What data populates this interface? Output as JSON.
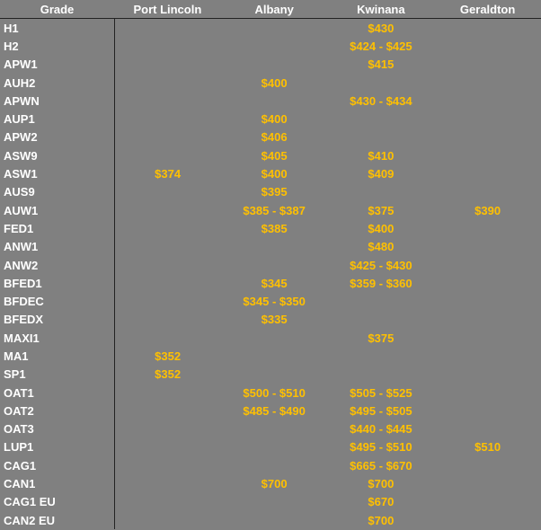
{
  "colors": {
    "background": "#808080",
    "price": "#FFC000",
    "header": "#FFFFFF"
  },
  "columns": [
    "Grade",
    "Port Lincoln",
    "Albany",
    "Kwinana",
    "Geraldton"
  ],
  "rows": [
    [
      "H1",
      "",
      "",
      "$430",
      ""
    ],
    [
      "H2",
      "",
      "",
      "$424 - $425",
      ""
    ],
    [
      "APW1",
      "",
      "",
      "$415",
      ""
    ],
    [
      "AUH2",
      "",
      "$400",
      "",
      ""
    ],
    [
      "APWN",
      "",
      "",
      "$430 - $434",
      ""
    ],
    [
      "AUP1",
      "",
      "$400",
      "",
      ""
    ],
    [
      "APW2",
      "",
      "$406",
      "",
      ""
    ],
    [
      "ASW9",
      "",
      "$405",
      "$410",
      ""
    ],
    [
      "ASW1",
      "$374",
      "$400",
      "$409",
      ""
    ],
    [
      "AUS9",
      "",
      "$395",
      "",
      ""
    ],
    [
      "AUW1",
      "",
      "$385 - $387",
      "$375",
      "$390"
    ],
    [
      "FED1",
      "",
      "$385",
      "$400",
      ""
    ],
    [
      "ANW1",
      "",
      "",
      "$480",
      ""
    ],
    [
      "ANW2",
      "",
      "",
      "$425 - $430",
      ""
    ],
    [
      "BFED1",
      "",
      "$345",
      "$359 - $360",
      ""
    ],
    [
      "BFDEC",
      "",
      "$345 - $350",
      "",
      ""
    ],
    [
      "BFEDX",
      "",
      "$335",
      "",
      ""
    ],
    [
      "MAXI1",
      "",
      "",
      "$375",
      ""
    ],
    [
      "MA1",
      "$352",
      "",
      "",
      ""
    ],
    [
      "SP1",
      "$352",
      "",
      "",
      ""
    ],
    [
      "OAT1",
      "",
      "$500 - $510",
      "$505 - $525",
      ""
    ],
    [
      "OAT2",
      "",
      "$485 - $490",
      "$495 - $505",
      ""
    ],
    [
      "OAT3",
      "",
      "",
      "$440 - $445",
      ""
    ],
    [
      "LUP1",
      "",
      "",
      "$495 - $510",
      "$510"
    ],
    [
      "CAG1",
      "",
      "",
      "$665 - $670",
      ""
    ],
    [
      "CAN1",
      "",
      "$700",
      "$700",
      ""
    ],
    [
      "CAG1 EU",
      "",
      "",
      "$670",
      ""
    ],
    [
      "CAN2 EU",
      "",
      "",
      "$700",
      ""
    ]
  ]
}
